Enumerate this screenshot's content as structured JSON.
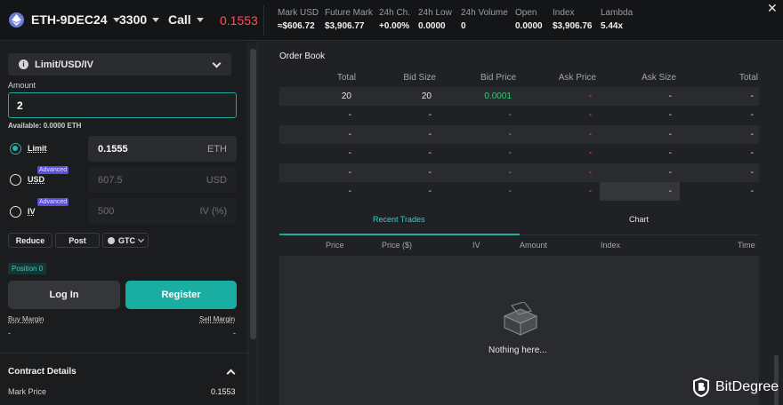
{
  "topbar": {
    "instrument": "ETH-9DEC24",
    "strike": "3300",
    "option_type": "Call",
    "last_price": "0.1553",
    "price_color": "#ff4d5e",
    "stats": [
      {
        "label": "Mark USD",
        "value": "≈$606.72"
      },
      {
        "label": "Future Mark",
        "value": "$3,906.77"
      },
      {
        "label": "24h Ch.",
        "value": "+0.00%"
      },
      {
        "label": "24h Low",
        "value": "0.0000"
      },
      {
        "label": "24h Volume",
        "value": "0"
      },
      {
        "label": "Open",
        "value": "0.0000"
      },
      {
        "label": "Index",
        "value": "$3,906.76"
      },
      {
        "label": "Lambda",
        "value": "5.44x"
      }
    ],
    "close_icon": "close-icon"
  },
  "order_form": {
    "order_type": "Limit/USD/IV",
    "amount_label": "Amount",
    "amount_value": "2",
    "available": "Available: 0.0000 ETH",
    "limit": {
      "label": "Limit",
      "value": "0.1555",
      "unit": "ETH"
    },
    "usd": {
      "label": "USD",
      "badge": "Advanced",
      "value": "607.5",
      "unit": "USD"
    },
    "iv": {
      "label": "IV",
      "badge": "Advanced",
      "value": "500",
      "unit": "IV (%)"
    },
    "reduce_label": "Reduce",
    "post_label": "Post",
    "tif_label": "GTC",
    "position_label": "Position 0",
    "login_label": "Log In",
    "register_label": "Register",
    "buy_margin_label": "Buy Margin",
    "buy_margin_value": "-",
    "sell_margin_label": "Sell Margin",
    "sell_margin_value": "-",
    "accent": "#1aaea2"
  },
  "contract_details": {
    "title": "Contract Details",
    "mark_price_label": "Mark Price",
    "mark_price_value": "0.1553"
  },
  "order_book": {
    "title": "Order Book",
    "columns": [
      "Total",
      "Bid Size",
      "Bid Price",
      "Ask Price",
      "Ask Size",
      "Total"
    ],
    "rows": [
      [
        "20",
        "20",
        "0.0001",
        "-",
        "-",
        "-"
      ],
      [
        "-",
        "-",
        "-",
        "-",
        "-",
        "-"
      ],
      [
        "-",
        "-",
        "-",
        "-",
        "-",
        "-"
      ],
      [
        "-",
        "-",
        "-",
        "-",
        "-",
        "-"
      ],
      [
        "-",
        "-",
        "-",
        "-",
        "-",
        "-"
      ],
      [
        "-",
        "-",
        "-",
        "-",
        "-",
        "-"
      ]
    ],
    "bid_color": "#2fcf7a",
    "ask_color": "#ff4d5e"
  },
  "trades": {
    "tabs": [
      "Recent Trades",
      "Chart"
    ],
    "columns": [
      "Price",
      "Price ($)",
      "IV",
      "Amount",
      "Index",
      "Time"
    ],
    "empty_text": "Nothing here..."
  },
  "watermark": {
    "text": "BitDegree"
  }
}
